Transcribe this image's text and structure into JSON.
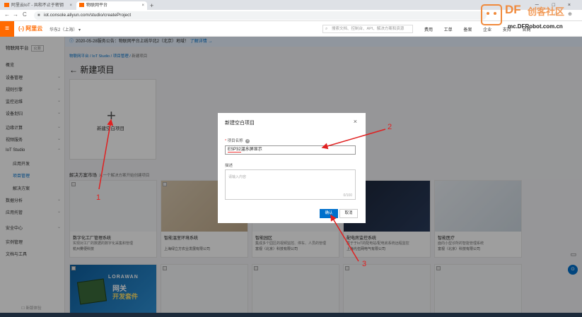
{
  "browser": {
    "tabs": [
      {
        "label": "阿里云IoT - 共和不止于密钥",
        "close": "×"
      },
      {
        "label": "物联网平台",
        "close": "×"
      }
    ],
    "new_tab": "+",
    "window_controls": "－ □ ×",
    "nav": {
      "back": "←",
      "forward": "→",
      "reload": "C"
    },
    "url": "iot.console.aliyun.com/studio/createProject",
    "tools": "☆ ⊕"
  },
  "watermark": {
    "brand": "DF",
    "cn": "创客社区",
    "site": "mc.DFRobot.com.cn"
  },
  "header": {
    "menu_icon": "≡",
    "logo": "(-) 阿里云",
    "region": "华东2（上海） ▾",
    "search_placeholder": "搜索文档、控制台、API、解决方案和资源",
    "links": [
      "费用",
      "工单",
      "备案",
      "企业",
      "支持",
      "官网"
    ]
  },
  "sidebar": {
    "title": "物联网平台",
    "tag": "公测",
    "items": [
      {
        "label": "概览",
        "chev": ""
      },
      {
        "label": "设备管理",
        "chev": "⌄"
      },
      {
        "label": "规则引擎",
        "chev": "⌄"
      },
      {
        "label": "监控运维",
        "chev": "⌄"
      },
      {
        "label": "设备划归",
        "chev": "⌄"
      },
      {
        "label": "边缘计算",
        "chev": "⌄"
      },
      {
        "label": "视频服务",
        "chev": "⌄"
      },
      {
        "label": "IoT Studio",
        "chev": "⌃"
      },
      {
        "label": "应用开发",
        "chev": ""
      },
      {
        "label": "项目管理",
        "chev": ""
      },
      {
        "label": "解决方案",
        "chev": ""
      },
      {
        "label": "数据分析",
        "chev": "⌄"
      },
      {
        "label": "应用托管",
        "chev": "⌄"
      },
      {
        "label": "安全中心",
        "chev": "⌄"
      },
      {
        "label": "实例管理",
        "chev": ""
      },
      {
        "label": "文档与工具",
        "chev": ""
      }
    ],
    "footer": "☐ 新版体验"
  },
  "notice": {
    "icon": "ⓘ",
    "text": "2020-05-28服务公告：物联网平台上线华北2（北京）地域！",
    "link": "了解详情 →"
  },
  "breadcrumb": {
    "items": [
      "物联网平台",
      "IoT Studio",
      "项目管理"
    ],
    "sep": "/",
    "current": "新建项目"
  },
  "page": {
    "back_icon": "←",
    "title": "新建项目"
  },
  "new_card": {
    "plus": "+",
    "label": "新建空白项目"
  },
  "solutions": {
    "title": "解决方案市场",
    "subtitle": "从一个解决方案开始创建项目",
    "cards": [
      {
        "name": "数字化工厂管理系统",
        "desc": "实现对工厂的数据的数字化采集和管理",
        "org": "杭州雾便科技",
        "style": "plain"
      },
      {
        "name": "智能温室环境系统",
        "desc": "",
        "org": "上海绿立方农业发展有限公司",
        "style": "warm"
      },
      {
        "name": "智能园区",
        "desc": "集成多个园区的视频监控、停车、人员的管理",
        "org": "富视（北京）科技有限公司",
        "style": "plain"
      },
      {
        "name": "配电房监控系统",
        "desc": "基于于IoT的配电站/配电房系统远程监控",
        "org": "上海光伍网电气有限公司",
        "style": "dark"
      },
      {
        "name": "智能医疗",
        "desc": "面向小型诊所的智能管理系统",
        "org": "富视（北京）科技有限公司",
        "style": "med"
      },
      {
        "name": "",
        "desc": "",
        "org": "",
        "style": "lora",
        "banner": [
          "LORAWAN",
          "网关",
          "开发套件"
        ]
      },
      {
        "name": "",
        "desc": "",
        "org": "",
        "style": "plain"
      },
      {
        "name": "",
        "desc": "",
        "org": "",
        "style": "plain"
      },
      {
        "name": "",
        "desc": "",
        "org": "",
        "style": "plain"
      },
      {
        "name": "",
        "desc": "",
        "org": "",
        "style": "plain"
      }
    ]
  },
  "modal": {
    "title": "新建空白项目",
    "close": "×",
    "name_label": "项目名称",
    "required_mark": "*",
    "help_icon": "?",
    "name_value_prefix": "ESP32",
    "name_value_rest": "温水屏显示",
    "desc_label": "描述",
    "desc_placeholder": "请输入内容",
    "desc_counter": "0/100",
    "ok_label": "确认",
    "cancel_label": "取消"
  },
  "annotations": {
    "numbers": [
      "1",
      "2",
      "3"
    ],
    "color": "#e02020"
  },
  "floating": {
    "chat": "▭",
    "help": "⊙"
  },
  "colors": {
    "brand": "#ff6a00",
    "primary": "#0070cc",
    "annotation": "#e02020"
  }
}
